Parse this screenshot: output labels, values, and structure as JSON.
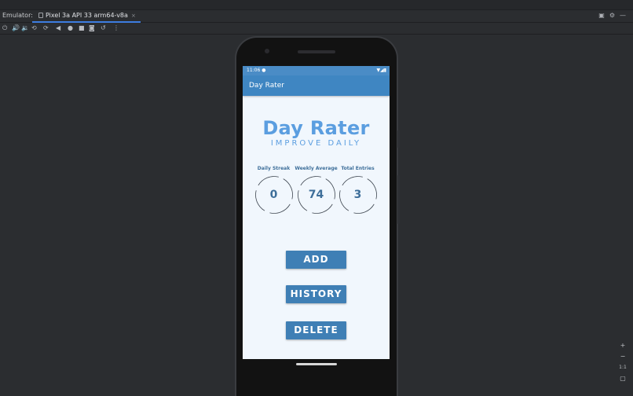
{
  "ide": {
    "emulator_label": "Emulator:",
    "device_tab": "Pixel 3a API 33 arm64-v8a",
    "tab_close": "×",
    "zoom_in": "+",
    "zoom_out": "−",
    "zoom_reset": "1:1"
  },
  "toolbar": {
    "icons": [
      "power-icon",
      "volume-up-icon",
      "volume-down-icon",
      "rotate-left-icon",
      "rotate-right-icon",
      "back-icon",
      "home-icon",
      "overview-icon",
      "screenshot-icon",
      "snapshot-icon",
      "more-icon"
    ]
  },
  "phone": {
    "status_time": "11:06",
    "app_title": "Day Rater"
  },
  "app": {
    "title": "Day Rater",
    "subtitle": "IMPROVE DAILY",
    "stats": [
      {
        "label": "Daily Streak",
        "value": "0"
      },
      {
        "label": "Weekly Average",
        "value": "74"
      },
      {
        "label": "Total Entries",
        "value": "3"
      }
    ],
    "buttons": {
      "add": "ADD",
      "history": "HISTORY",
      "delete": "DELETE"
    }
  },
  "colors": {
    "accent": "#3f7fb5",
    "app_bar": "#3f86c2",
    "title_blue": "#5b9ee0",
    "screen_bg": "#f1f7fd"
  }
}
